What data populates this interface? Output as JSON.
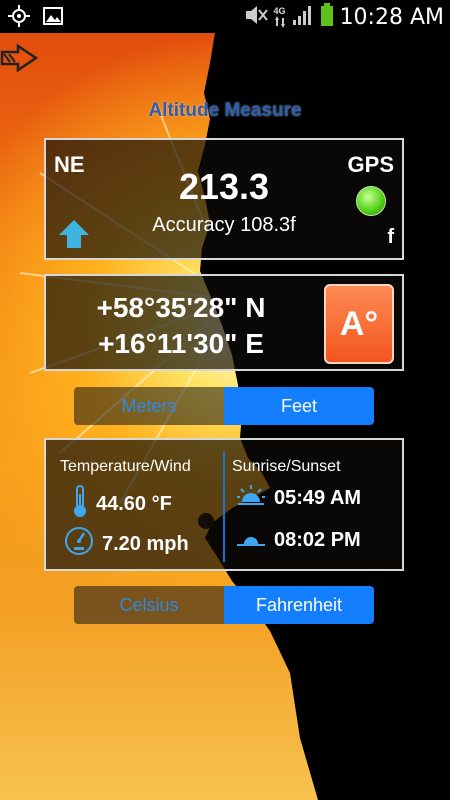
{
  "status_bar": {
    "time": "10:28 AM",
    "network": "4G",
    "icons": [
      "gps-icon",
      "image-icon",
      "mute-icon",
      "signal-icon",
      "battery-icon"
    ]
  },
  "header": {
    "title": "Altitude Measure",
    "back_icon": "arrow-right-icon"
  },
  "altitude_panel": {
    "direction": "NE",
    "gps_label": "GPS",
    "gps_status_color": "#55d41a",
    "altitude": "213.3",
    "accuracy": "Accuracy 108.3f",
    "unit": "f",
    "trend_icon": "arrow-up-icon"
  },
  "coordinates_panel": {
    "latitude": "+58°35'28\" N",
    "longitude": "+16°11'30\" E",
    "button_label": "A°",
    "button_color": "#f2561e"
  },
  "unit_toggle": {
    "options": [
      "Meters",
      "Feet"
    ],
    "selected": "Feet"
  },
  "weather_panel": {
    "temp_wind_header": "Temperature/Wind",
    "temperature": "44.60 °F",
    "wind": "7.20 mph",
    "sun_header": "Sunrise/Sunset",
    "sunrise": "05:49 AM",
    "sunset": "08:02 PM"
  },
  "temp_toggle": {
    "options": [
      "Celsius",
      "Fahrenheit"
    ],
    "selected": "Fahrenheit"
  },
  "colors": {
    "accent_blue": "#137fff",
    "title_blue": "#2b5fb0",
    "sky_orange": "#f17a14"
  }
}
